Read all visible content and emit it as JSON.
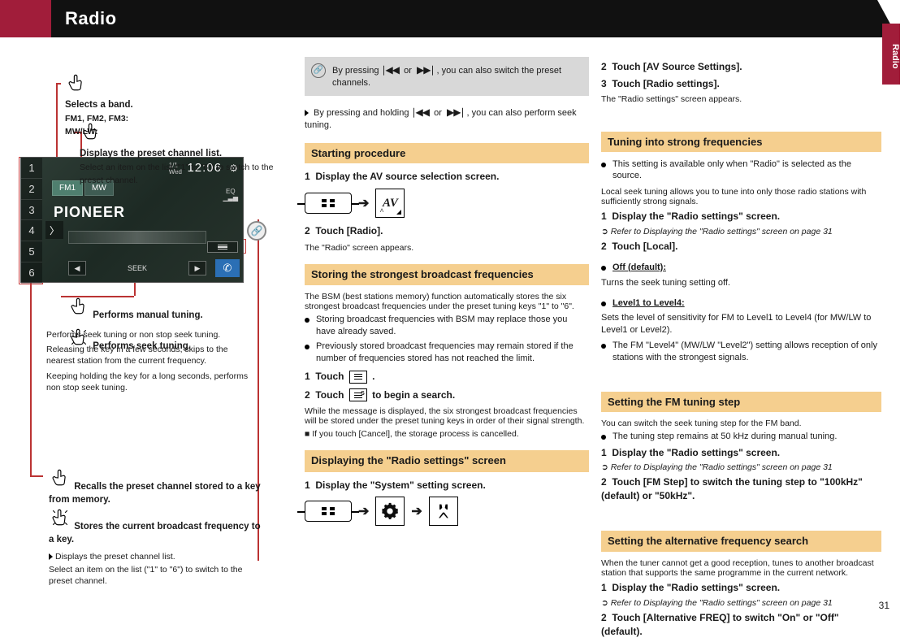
{
  "banner": {
    "title": "Radio",
    "side_tab": "Radio"
  },
  "radio": {
    "presets": [
      "1",
      "2",
      "3",
      "4",
      "5",
      "6"
    ],
    "date": "1/1",
    "weekday": "Wed",
    "clock": "12:06",
    "eq_label": "EQ",
    "band_fm": "FM1",
    "band_mw": "MW",
    "station": "PIONEER",
    "seek_label": "SEEK"
  },
  "left": {
    "bands": {
      "label": "Selects a band.",
      "sub1": "FM1, FM2, FM3:",
      "sub2": "MW/LW:"
    },
    "display_preset": "Displays the preset channel list.",
    "display_preset_sub": "Select an item on the list (\"1\" to \"6\") to switch to the preset channel.",
    "seek_manual": "Performs manual tuning.",
    "seek_hold": "Performs seek tuning.",
    "note_seek": {
      "p": "Performs seek tuning or non stop seek tuning.",
      "rel": "Releasing the key in a few seconds, skips to the nearest station from the current frequency.",
      "keep": "Keeping holding the key for a long seconds, performs non stop seek tuning."
    },
    "stored": {
      "recall": "Recalls the preset channel stored to a key from memory.",
      "store": "Stores the current broadcast frequency to a key.",
      "tip_label": "Displays the preset channel list.",
      "tip_sub": "Select an item on the list (\"1\" to \"6\") to switch to the preset channel."
    }
  },
  "link_box": "By pressing         or        , you can also switch the preset channels.",
  "mid": {
    "press_hold": "By pressing and holding          or         , you can also perform seek tuning.",
    "h_start": "Starting procedure",
    "s1": {
      "n": "1",
      "t": "Display the AV source selection screen."
    },
    "s2": {
      "n": "2",
      "t": "Touch [Radio].",
      "sub": "The \"Radio\" screen appears."
    },
    "h_bsm": "Storing the strongest broadcast frequencies",
    "bsm_intro": "The BSM (best stations memory) function automatically stores the six strongest broadcast frequencies under the preset tuning keys \"1\" to \"6\".",
    "bsm_note1": "Storing broadcast frequencies with BSM may replace those you have already saved.",
    "bsm_note2": "Previously stored broadcast frequencies may remain stored if the number of frequencies stored has not reached the limit.",
    "bsm1": {
      "n": "1",
      "pre": "Touch ",
      "post": "."
    },
    "bsm2": {
      "n": "2",
      "pre": "Touch ",
      "post": " to begin a search.",
      "sub": "While the message is displayed, the six strongest broadcast frequencies will be stored under the preset tuning keys in order of their signal strength.",
      "cancel_h": "If you touch [Cancel], the storage process is cancelled."
    },
    "h_settings": "Displaying the \"Radio settings\" screen",
    "set1": {
      "n": "1",
      "t": "Display the \"System\" setting screen."
    }
  },
  "right": {
    "s2": {
      "n": "2",
      "t": "Touch [AV Source Settings]."
    },
    "s3": {
      "n": "3",
      "t": "Touch [Radio settings].",
      "sub": "The \"Radio settings\" screen appears."
    },
    "h_step": "Tuning into strong frequencies",
    "step_note": "This setting is available only when \"Radio\" is selected as the source.",
    "step_intro": "Local seek tuning allows you to tune into only those radio stations with sufficiently strong signals.",
    "step1": {
      "n": "1",
      "t": "Display the \"Radio settings\" screen.",
      "ref": "Refer to Displaying the \"Radio settings\" screen on page 31"
    },
    "step2": {
      "n": "2",
      "t": "Touch [Local].",
      "off_h": "Off (default):",
      "off_d": "Turns the seek tuning setting off.",
      "lv_fm": "Level1 to Level4:",
      "lv_fm_d": "Sets the level of sensitivity for FM to Level1 to Level4 (for MW/LW to Level1 or Level2).",
      "lv_note": "The FM \"Level4\" (MW/LW \"Level2\") setting allows reception of only stations with the strongest signals."
    },
    "h_fm": "Setting the FM tuning step",
    "fm_intro": "You can switch the seek tuning step for the FM band.",
    "fm_note": "The tuning step remains at 50 kHz during manual tuning.",
    "fm1": {
      "n": "1",
      "t": "Display the \"Radio settings\" screen.",
      "ref": "Refer to Displaying the \"Radio settings\" screen on page 31"
    },
    "fm2": {
      "n": "2",
      "t": "Touch [FM Step] to switch the tuning step to \"100kHz\" (default) or \"50kHz\"."
    },
    "h_af": "Setting the alternative frequency search",
    "af_intro": "When the tuner cannot get a good reception, tunes to another broadcast station that supports the same programme in the current network.",
    "af1": {
      "n": "1",
      "t": "Display the \"Radio settings\" screen.",
      "ref": "Refer to Displaying the \"Radio settings\" screen on page 31"
    },
    "af2": {
      "n": "2",
      "t": "Touch [Alternative FREQ] to switch \"On\" or \"Off\" (default)."
    }
  },
  "page": "31",
  "icon_labels": {
    "home": "home-button",
    "av": "AV",
    "gear": "settings-icon",
    "wrench": "system-icon"
  }
}
